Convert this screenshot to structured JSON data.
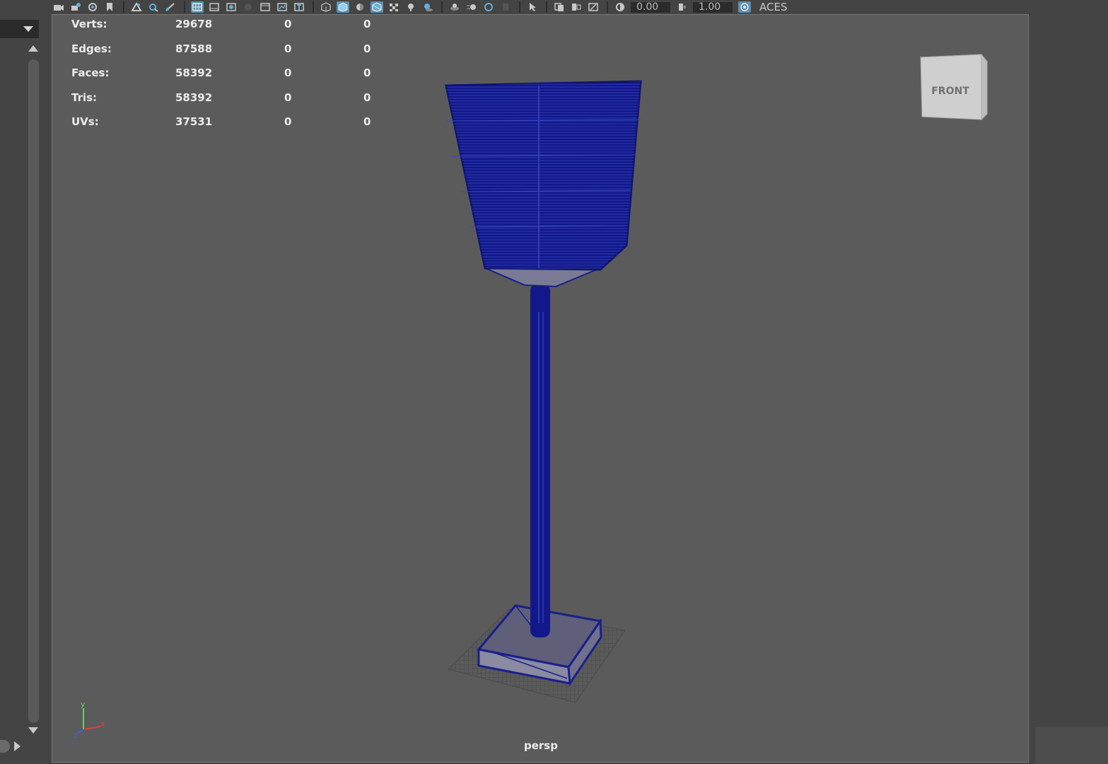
{
  "toolbar": {
    "exposure_value": "0.00",
    "gamma_value": "1.00",
    "color_space_label": "ACES",
    "icons": [
      "camera-icon",
      "select-camera-icon",
      "camera-attributes-icon",
      "bookmark-icon",
      "image-plane-icon",
      "grid-toggle-icon",
      "film-gate-icon",
      "resolution-gate-icon",
      "gate-mask-icon",
      "field-chart-icon",
      "safe-action-icon",
      "safe-title-icon",
      "wireframe-icon",
      "smooth-shade-icon",
      "default-material-icon",
      "wireframe-on-shaded-icon",
      "textured-icon",
      "use-lights-icon",
      "shadows-icon",
      "screen-space-ao-icon",
      "motion-blur-icon",
      "anti-aliasing-icon",
      "isolate-select-icon",
      "xray-icon",
      "xray-joints-icon",
      "exposure-icon",
      "gamma-icon",
      "color-management-icon"
    ]
  },
  "hud": {
    "rows": [
      {
        "label": "Verts:",
        "total": "29678",
        "selected": "0",
        "uv": "0"
      },
      {
        "label": "Edges:",
        "total": "87588",
        "selected": "0",
        "uv": "0"
      },
      {
        "label": "Faces:",
        "total": "58392",
        "selected": "0",
        "uv": "0"
      },
      {
        "label": "Tris:",
        "total": "58392",
        "selected": "0",
        "uv": "0"
      },
      {
        "label": "UVs:",
        "total": "37531",
        "selected": "0",
        "uv": "0"
      }
    ]
  },
  "view_cube": {
    "face_label": "FRONT"
  },
  "camera": {
    "name": "persp"
  },
  "axis": {
    "x": "x",
    "y": "y",
    "z": "z"
  },
  "colors": {
    "viewport_bg": "#5b5b5b",
    "wireframe": "#1a1f8a",
    "panel_bg": "#444444",
    "active_icon": "#5a8fb5"
  }
}
